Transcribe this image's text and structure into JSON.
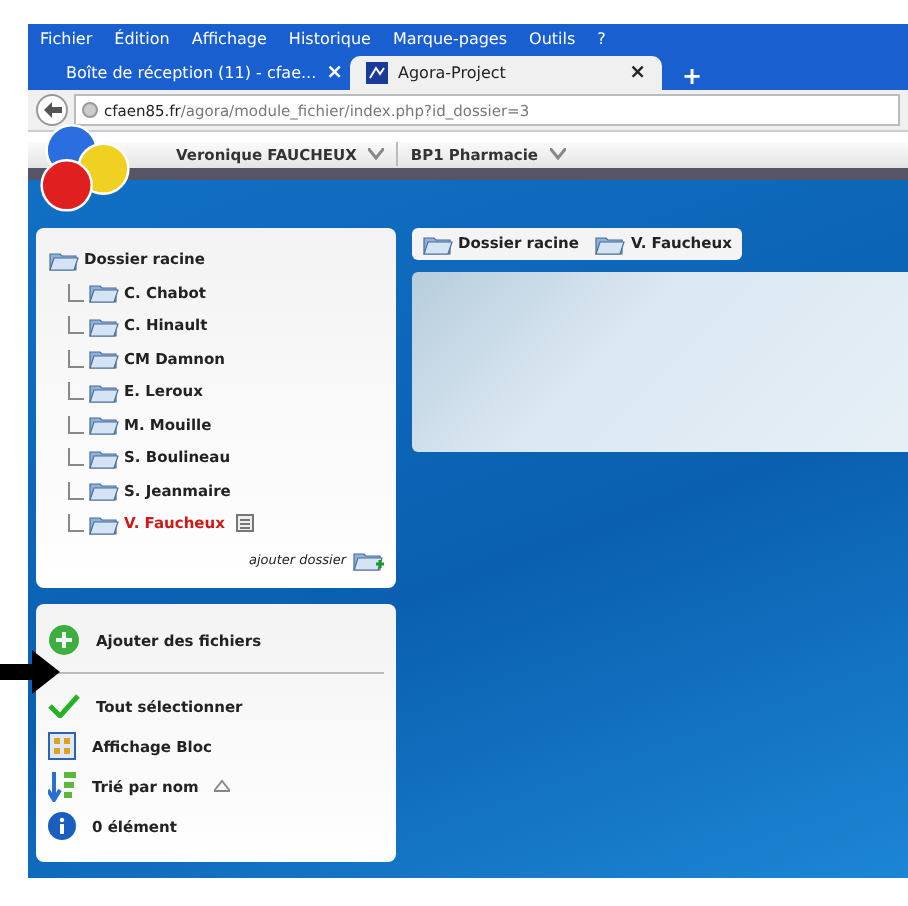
{
  "menu_bar": [
    "Fichier",
    "Édition",
    "Affichage",
    "Historique",
    "Marque-pages",
    "Outils",
    "?"
  ],
  "tabs": [
    {
      "label": "Boîte de réception (11) - cfae...",
      "selected": false,
      "close": "×"
    },
    {
      "label": "Agora-Project",
      "selected": true,
      "close": "×"
    }
  ],
  "new_tab": "+",
  "address": {
    "host": "cfaen85.fr",
    "path": "/agora/module_fichier/index.php?id_dossier=3"
  },
  "header": {
    "user": "Veronique FAUCHEUX",
    "space": "BP1 Pharmacie"
  },
  "tree": {
    "label": "Dossier racine",
    "selected": false,
    "children": [
      {
        "label": "C. Chabot",
        "selected": false
      },
      {
        "label": "C. Hinault",
        "selected": false
      },
      {
        "label": "CM Damnon",
        "selected": false
      },
      {
        "label": "E. Leroux",
        "selected": false
      },
      {
        "label": "M. Mouille",
        "selected": false
      },
      {
        "label": "S. Boulineau",
        "selected": false
      },
      {
        "label": "S. Jeanmaire",
        "selected": false
      },
      {
        "label": "V. Faucheux",
        "selected": true
      }
    ]
  },
  "add_folder": "ajouter dossier",
  "actions": [
    {
      "kind": "add",
      "label": "Ajouter des fichiers"
    },
    {
      "kind": "select",
      "label": "Tout sélectionner"
    },
    {
      "kind": "view",
      "label": "Affichage Bloc"
    },
    {
      "kind": "sort",
      "label": "Trié par nom"
    },
    {
      "kind": "info",
      "label": "0 élément"
    }
  ],
  "breadcrumb": [
    "Dossier racine",
    "V. Faucheux"
  ]
}
